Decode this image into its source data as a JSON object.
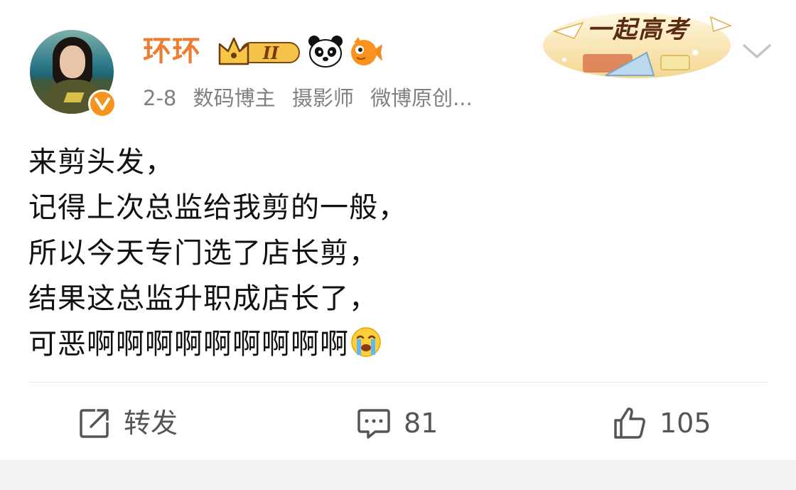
{
  "post": {
    "author": {
      "name": "环环",
      "badges": [
        "crown-level-badge",
        "panda-emoji",
        "fish-emoji"
      ],
      "crown_level": "II",
      "verified_icon": "verified-v-icon"
    },
    "meta": {
      "date": "2-8",
      "tags": [
        "数码博主",
        "摄影师",
        "微博原创..."
      ]
    },
    "banner": {
      "text": "一起高考"
    },
    "content": {
      "lines": [
        "来剪头发，",
        "记得上次总监给我剪的一般，",
        "所以今天专门选了店长剪，",
        "结果这总监升职成店长了，",
        "可恶啊啊啊啊啊啊啊啊啊"
      ],
      "trailing_emoji": "crying-face-emoji"
    },
    "actions": {
      "repost": {
        "label": "转发",
        "icon": "repost-icon"
      },
      "comment": {
        "count": "81",
        "icon": "comment-icon"
      },
      "like": {
        "count": "105",
        "icon": "thumbs-up-icon"
      }
    }
  },
  "colors": {
    "username": "#eb7e32",
    "verified": "#f7941d",
    "meta": "#808080",
    "text": "#111111",
    "action": "#555555",
    "bottom_bar": "#f2f2f2"
  }
}
